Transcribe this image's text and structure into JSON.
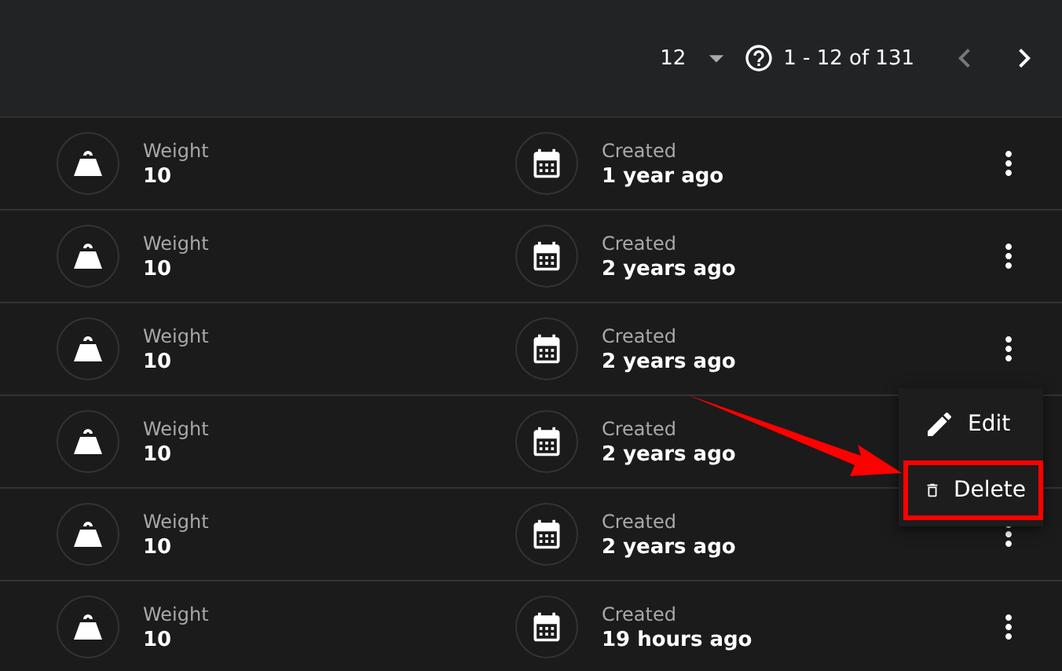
{
  "pagination": {
    "page_size": "12",
    "range": "1 - 12 of 131",
    "prev_disabled": true,
    "next_disabled": false
  },
  "rows": [
    {
      "weight_label": "Weight",
      "weight": "10",
      "created_label": "Created",
      "created": "1 year ago",
      "actions_visible": true
    },
    {
      "weight_label": "Weight",
      "weight": "10",
      "created_label": "Created",
      "created": "2 years ago",
      "actions_visible": true
    },
    {
      "weight_label": "Weight",
      "weight": "10",
      "created_label": "Created",
      "created": "2 years ago",
      "actions_visible": true
    },
    {
      "weight_label": "Weight",
      "weight": "10",
      "created_label": "Created",
      "created": "2 years ago",
      "actions_visible": false
    },
    {
      "weight_label": "Weight",
      "weight": "10",
      "created_label": "Created",
      "created": "2 years ago",
      "actions_visible": true
    },
    {
      "weight_label": "Weight",
      "weight": "10",
      "created_label": "Created",
      "created": "19 hours ago",
      "actions_visible": true
    }
  ],
  "menu": {
    "items": [
      {
        "kind": "edit",
        "label": "Edit",
        "highlighted": false
      },
      {
        "kind": "delete",
        "label": "Delete",
        "highlighted": true
      }
    ]
  },
  "annotation": {
    "arrow": true
  }
}
